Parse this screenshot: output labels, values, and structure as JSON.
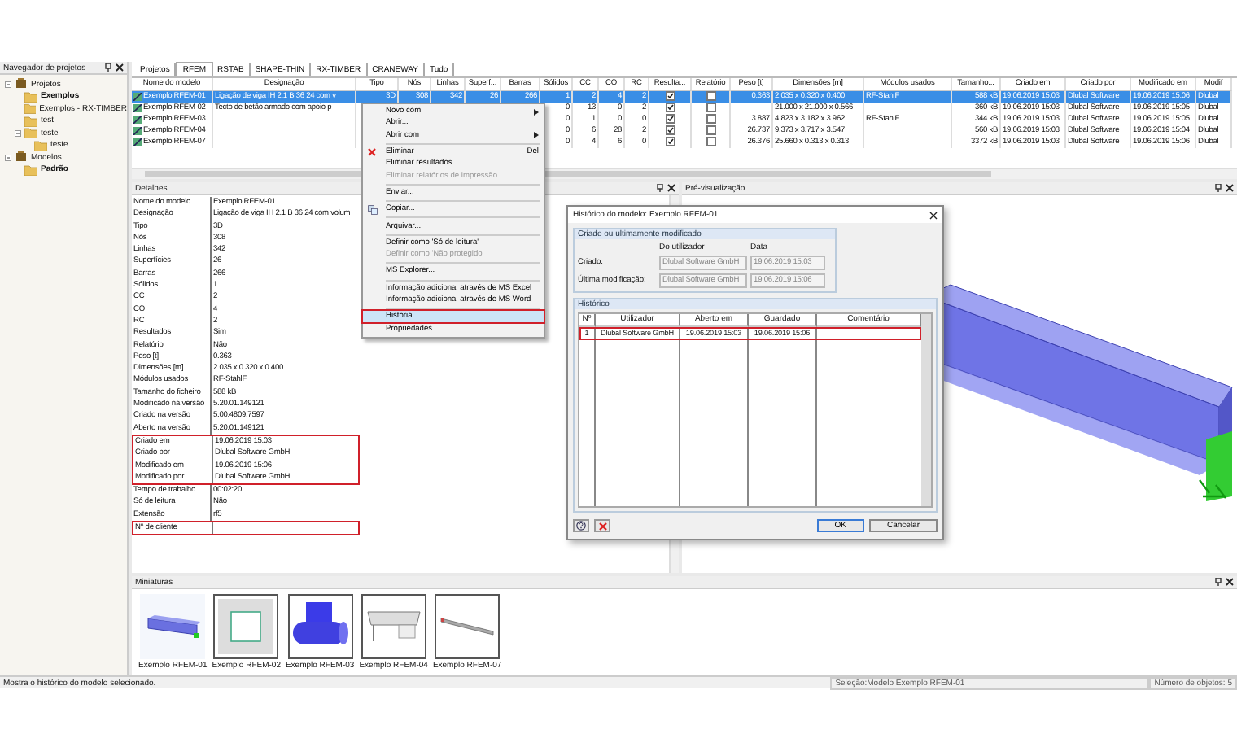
{
  "navigator": {
    "title": "Navegador de projetos",
    "tree": [
      {
        "label": "Projetos",
        "kind": "folder-root",
        "current": false,
        "children": [
          {
            "label": "Exemplos",
            "kind": "folder",
            "current": true
          },
          {
            "label": "Exemplos - RX-TIMBER",
            "kind": "folder",
            "current": false
          },
          {
            "label": "test",
            "kind": "folder",
            "current": false
          },
          {
            "label": "teste",
            "kind": "folder",
            "current": false,
            "children": [
              {
                "label": "teste",
                "kind": "folder",
                "current": false
              }
            ]
          }
        ]
      },
      {
        "label": "Modelos",
        "kind": "folder-root",
        "current": false,
        "children": [
          {
            "label": "Padrão",
            "kind": "folder",
            "current": true
          }
        ]
      }
    ]
  },
  "tabs": [
    {
      "label": "Projetos",
      "selected": false
    },
    {
      "label": "RFEM",
      "selected": true
    },
    {
      "label": "RSTAB",
      "selected": false
    },
    {
      "label": "SHAPE-THIN",
      "selected": false
    },
    {
      "label": "RX-TIMBER",
      "selected": false
    },
    {
      "label": "CRANEWAY",
      "selected": false
    },
    {
      "label": "Tudo",
      "selected": false
    }
  ],
  "table": {
    "columns": [
      "Nome do modelo",
      "Designação",
      "Tipo",
      "Nós",
      "Linhas",
      "Superf...",
      "Barras",
      "Sólidos",
      "CC",
      "CO",
      "RC",
      "Resulta...",
      "Relatório",
      "Peso [t]",
      "Dimensões [m]",
      "Módulos usados",
      "Tamanho...",
      "Criado em",
      "Criado por",
      "Modificado em",
      "Modif"
    ],
    "rows": [
      {
        "selected": true,
        "cells": [
          "Exemplo RFEM-01",
          "Ligação de viga IH 2.1 B 36 24 com v",
          "3D",
          "308",
          "342",
          "26",
          "266",
          "1",
          "2",
          "4",
          "2",
          {
            "checked": true
          },
          {
            "checked": false
          },
          "0.363",
          "2.035 x 0.320 x 0.400",
          "RF-StahlF",
          "588 kB",
          "19.06.2019 15:03",
          "Dlubal Software",
          "19.06.2019 15:06",
          "Dlubal"
        ]
      },
      {
        "selected": false,
        "cells": [
          "Exemplo RFEM-02",
          "Tecto de betão armado com apoio p",
          null,
          null,
          null,
          null,
          null,
          "0",
          "13",
          "0",
          "2",
          {
            "checked": true
          },
          {
            "checked": false
          },
          null,
          "21.000 x 21.000 x 0.566",
          null,
          "360 kB",
          "19.06.2019 15:03",
          "Dlubal Software",
          "19.06.2019 15:05",
          "Dlubal"
        ]
      },
      {
        "selected": false,
        "cells": [
          "Exemplo RFEM-03",
          null,
          null,
          null,
          null,
          null,
          null,
          "0",
          "1",
          "0",
          "0",
          {
            "checked": true
          },
          {
            "checked": false
          },
          "3.887",
          "4.823 x 3.182 x 3.962",
          "RF-StahlF",
          "344 kB",
          "19.06.2019 15:03",
          "Dlubal Software",
          "19.06.2019 15:05",
          "Dlubal"
        ]
      },
      {
        "selected": false,
        "cells": [
          "Exemplo RFEM-04",
          null,
          null,
          null,
          null,
          null,
          null,
          "0",
          "6",
          "28",
          "2",
          {
            "checked": true
          },
          {
            "checked": false
          },
          "26.737",
          "9.373 x 3.717 x 3.547",
          null,
          "560 kB",
          "19.06.2019 15:03",
          "Dlubal Software",
          "19.06.2019 15:04",
          "Dlubal"
        ]
      },
      {
        "selected": false,
        "cells": [
          "Exemplo RFEM-07",
          null,
          null,
          null,
          null,
          null,
          null,
          "0",
          "4",
          "6",
          "0",
          {
            "checked": true
          },
          {
            "checked": false
          },
          "26.376",
          "25.660 x 0.313 x 0.313",
          null,
          "3372 kB",
          "19.06.2019 15:03",
          "Dlubal Software",
          "19.06.2019 15:06",
          "Dlubal"
        ]
      }
    ]
  },
  "details": {
    "title": "Detalhes",
    "blocks": [
      {
        "highlighted": false,
        "rows": [
          [
            "Nome do modelo",
            "Exemplo RFEM-01"
          ],
          [
            "Designação",
            "Ligação de viga IH 2.1 B 36 24 com volum"
          ],
          [
            "Tipo",
            "3D"
          ],
          [
            "Nós",
            "308"
          ],
          [
            "Linhas",
            "342"
          ],
          [
            "Superfícies",
            "26"
          ],
          [
            "Barras",
            "266"
          ],
          [
            "Sólidos",
            "1"
          ],
          [
            "CC",
            "2"
          ],
          [
            "CO",
            "4"
          ],
          [
            "RC",
            "2"
          ],
          [
            "Resultados",
            "Sim"
          ],
          [
            "Relatório",
            "Não"
          ],
          [
            "Peso [t]",
            "0.363"
          ],
          [
            "Dimensões [m]",
            "2.035 x 0.320 x 0.400"
          ],
          [
            "Módulos usados",
            "RF-StahlF"
          ],
          [
            "Tamanho do ficheiro",
            "588 kB"
          ],
          [
            "Modificado na versão",
            "5.20.01.149121"
          ],
          [
            "Criado na versão",
            "5.00.4809.7597"
          ],
          [
            "Aberto na versão",
            "5.20.01.149121"
          ]
        ]
      },
      {
        "highlighted": true,
        "rows": [
          [
            "Criado em",
            "19.06.2019 15:03"
          ],
          [
            "Criado por",
            "Dlubal Software GmbH"
          ],
          [
            "Modificado em",
            "19.06.2019 15:06"
          ],
          [
            "Modificado por",
            "Dlubal Software GmbH"
          ]
        ]
      },
      {
        "highlighted": false,
        "rows": [
          [
            "Tempo de trabalho",
            "00:02:20"
          ],
          [
            "Só de leitura",
            "Não"
          ],
          [
            "Extensão",
            "rf5"
          ]
        ]
      },
      {
        "highlighted": true,
        "rows": [
          [
            "Nº de cliente"
          ]
        ]
      }
    ]
  },
  "preview": {
    "title": "Pré-visualização"
  },
  "context_menu": {
    "items": [
      {
        "kind": "item",
        "label": "Novo com",
        "submenu": true,
        "disabled": false,
        "selected": false
      },
      {
        "kind": "item",
        "label": "Abrir...",
        "disabled": false,
        "selected": false
      },
      {
        "kind": "item",
        "label": "Abrir com",
        "submenu": true,
        "disabled": false,
        "selected": false
      },
      {
        "kind": "separator"
      },
      {
        "kind": "delete",
        "label": "Eliminar",
        "shortcut": "Del",
        "disabled": false,
        "selected": false
      },
      {
        "kind": "item",
        "label": "Eliminar resultados",
        "disabled": false,
        "selected": false
      },
      {
        "kind": "item",
        "label": "Eliminar relatórios de impressão",
        "disabled": true,
        "selected": false
      },
      {
        "kind": "separator"
      },
      {
        "kind": "item",
        "label": "Enviar...",
        "disabled": false,
        "selected": false
      },
      {
        "kind": "separator"
      },
      {
        "kind": "copy",
        "label": "Copiar...",
        "disabled": false,
        "selected": false
      },
      {
        "kind": "separator"
      },
      {
        "kind": "item",
        "label": "Arquivar...",
        "disabled": false,
        "selected": false
      },
      {
        "kind": "separator"
      },
      {
        "kind": "item",
        "label": "Definir como 'Só de leitura'",
        "disabled": false,
        "selected": false
      },
      {
        "kind": "item",
        "label": "Definir como 'Não protegido'",
        "disabled": true,
        "selected": false
      },
      {
        "kind": "separator"
      },
      {
        "kind": "item",
        "label": "MS Explorer...",
        "disabled": false,
        "selected": false
      },
      {
        "kind": "separator"
      },
      {
        "kind": "item",
        "label": "Informação adicional através de MS Excel",
        "disabled": false,
        "selected": false
      },
      {
        "kind": "item",
        "label": "Informação adicional através de MS Word",
        "disabled": false,
        "selected": false
      },
      {
        "kind": "separator"
      },
      {
        "kind": "item",
        "label": "Historial...",
        "disabled": false,
        "selected": true
      },
      {
        "kind": "item",
        "label": "Propriedades...",
        "disabled": false,
        "selected": false
      }
    ]
  },
  "dialog": {
    "title": "Histórico do modelo: Exemplo RFEM-01",
    "created_group": {
      "title": "Criado ou ultimamente modificado",
      "columns": [
        "Do utilizador",
        "Data"
      ],
      "rows": [
        {
          "label": "Criado:",
          "user": "Dlubal Software GmbH",
          "date": "19.06.2019 15:03"
        },
        {
          "label": "Última modificação:",
          "user": "Dlubal Software GmbH",
          "date": "19.06.2019 15:06"
        }
      ]
    },
    "history_group": {
      "title": "Histórico",
      "columns": [
        "Nº",
        "Utilizador",
        "Aberto em",
        "Guardado",
        "Comentário"
      ],
      "rows": [
        {
          "highlighted": true,
          "cells": [
            "1",
            "Dlubal Software GmbH",
            "19.06.2019 15:03",
            "19.06.2019 15:06"
          ]
        }
      ]
    },
    "buttons": [
      "OK",
      "Cancelar"
    ]
  },
  "thumbnails": {
    "title": "Miniaturas",
    "items": [
      {
        "caption": "Exemplo RFEM-01",
        "kind": "beam",
        "selected": true
      },
      {
        "caption": "Exemplo RFEM-02",
        "kind": "slab",
        "selected": false
      },
      {
        "caption": "Exemplo RFEM-03",
        "kind": "tee",
        "selected": false
      },
      {
        "caption": "Exemplo RFEM-04",
        "kind": "frame",
        "selected": false
      },
      {
        "caption": "Exemplo RFEM-07",
        "kind": "bar",
        "selected": false
      }
    ]
  },
  "status_bar": {
    "message": "Mostra o histórico do modelo selecionado.",
    "selection": "Seleção:Modelo Exemplo RFEM-01",
    "count": "Número de objetos: 5"
  }
}
